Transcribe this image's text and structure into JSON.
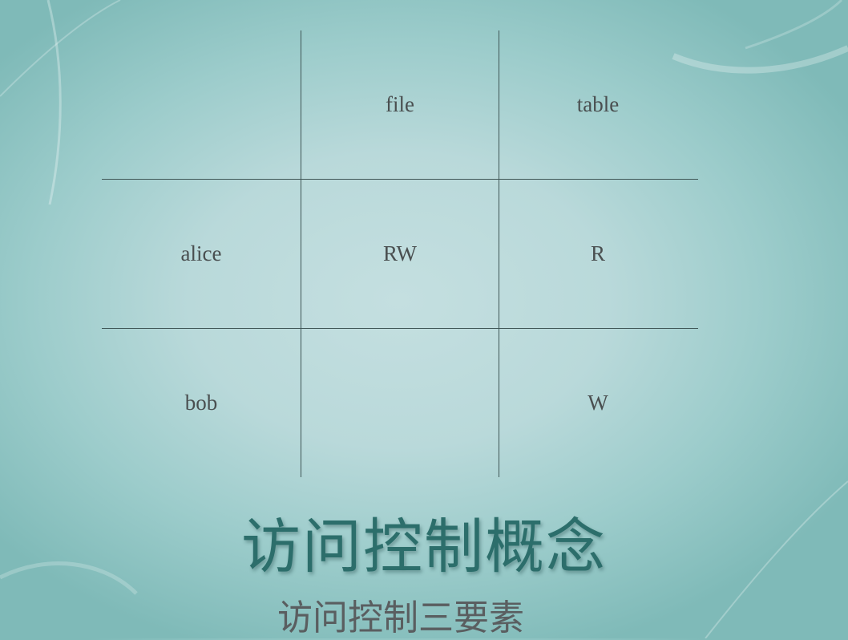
{
  "matrix": {
    "header": {
      "col1": "file",
      "col2": "table"
    },
    "rows": [
      {
        "subject": "alice",
        "file": "RW",
        "table": "R"
      },
      {
        "subject": "bob",
        "file": "",
        "table": "W"
      }
    ]
  },
  "title": "访问控制概念",
  "subtitle": "访问控制三要素"
}
